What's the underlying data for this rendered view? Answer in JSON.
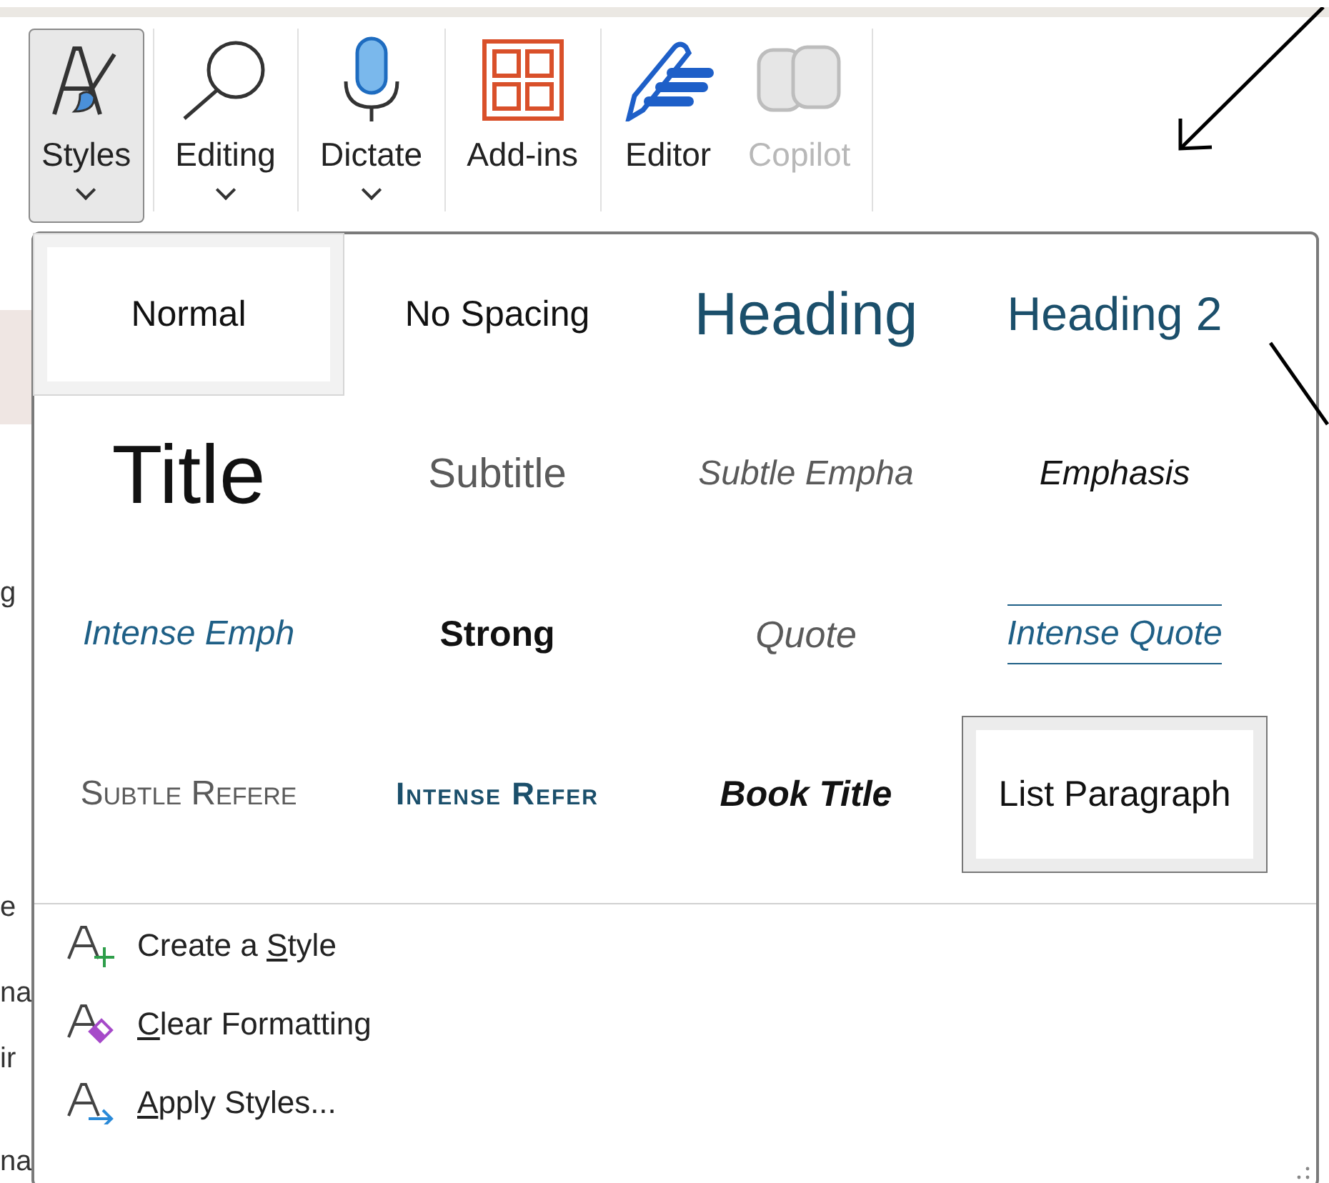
{
  "ribbon": {
    "buttons": [
      {
        "label": "Styles",
        "dropdown": true,
        "pressed": true,
        "disabled": false
      },
      {
        "label": "Editing",
        "dropdown": true,
        "pressed": false,
        "disabled": false
      },
      {
        "label": "Dictate",
        "dropdown": true,
        "pressed": false,
        "disabled": false
      },
      {
        "label": "Add-ins",
        "dropdown": false,
        "pressed": false,
        "disabled": false
      },
      {
        "label": "Editor",
        "dropdown": false,
        "pressed": false,
        "disabled": false
      },
      {
        "label": "Copilot",
        "dropdown": false,
        "pressed": false,
        "disabled": true
      }
    ]
  },
  "document_fragments": [
    "g",
    "e",
    "na",
    "ir",
    "na"
  ],
  "styles_gallery": {
    "items": [
      {
        "label": "Normal",
        "kind": "normal",
        "selected": true,
        "hovered": false
      },
      {
        "label": "No Spacing",
        "kind": "nospacing",
        "selected": false,
        "hovered": false
      },
      {
        "label": "Heading",
        "kind": "heading1",
        "selected": false,
        "hovered": false
      },
      {
        "label": "Heading 2",
        "kind": "heading2",
        "selected": false,
        "hovered": false
      },
      {
        "label": "Title",
        "kind": "title",
        "selected": false,
        "hovered": false
      },
      {
        "label": "Subtitle",
        "kind": "subtitle",
        "selected": false,
        "hovered": false
      },
      {
        "label": "Subtle Empha",
        "kind": "subtleemph",
        "selected": false,
        "hovered": false
      },
      {
        "label": "Emphasis",
        "kind": "emphasis",
        "selected": false,
        "hovered": false
      },
      {
        "label": "Intense Emph",
        "kind": "intenseemph",
        "selected": false,
        "hovered": false
      },
      {
        "label": "Strong",
        "kind": "strong",
        "selected": false,
        "hovered": false
      },
      {
        "label": "Quote",
        "kind": "quote",
        "selected": false,
        "hovered": false
      },
      {
        "label": "Intense Quote",
        "kind": "intensequote",
        "selected": false,
        "hovered": false
      },
      {
        "label": "Subtle Refere",
        "kind": "subtleref",
        "selected": false,
        "hovered": false
      },
      {
        "label": "Intense Refer",
        "kind": "intenseref",
        "selected": false,
        "hovered": false
      },
      {
        "label": "Book Title",
        "kind": "booktitle",
        "selected": false,
        "hovered": false
      },
      {
        "label": "List Paragraph",
        "kind": "listpara",
        "selected": false,
        "hovered": true
      }
    ]
  },
  "menu": [
    {
      "before": "Create a ",
      "key": "S",
      "after": "tyle"
    },
    {
      "key": "C",
      "after": "lear Formatting"
    },
    {
      "key": "A",
      "after": "pply Styles..."
    }
  ]
}
